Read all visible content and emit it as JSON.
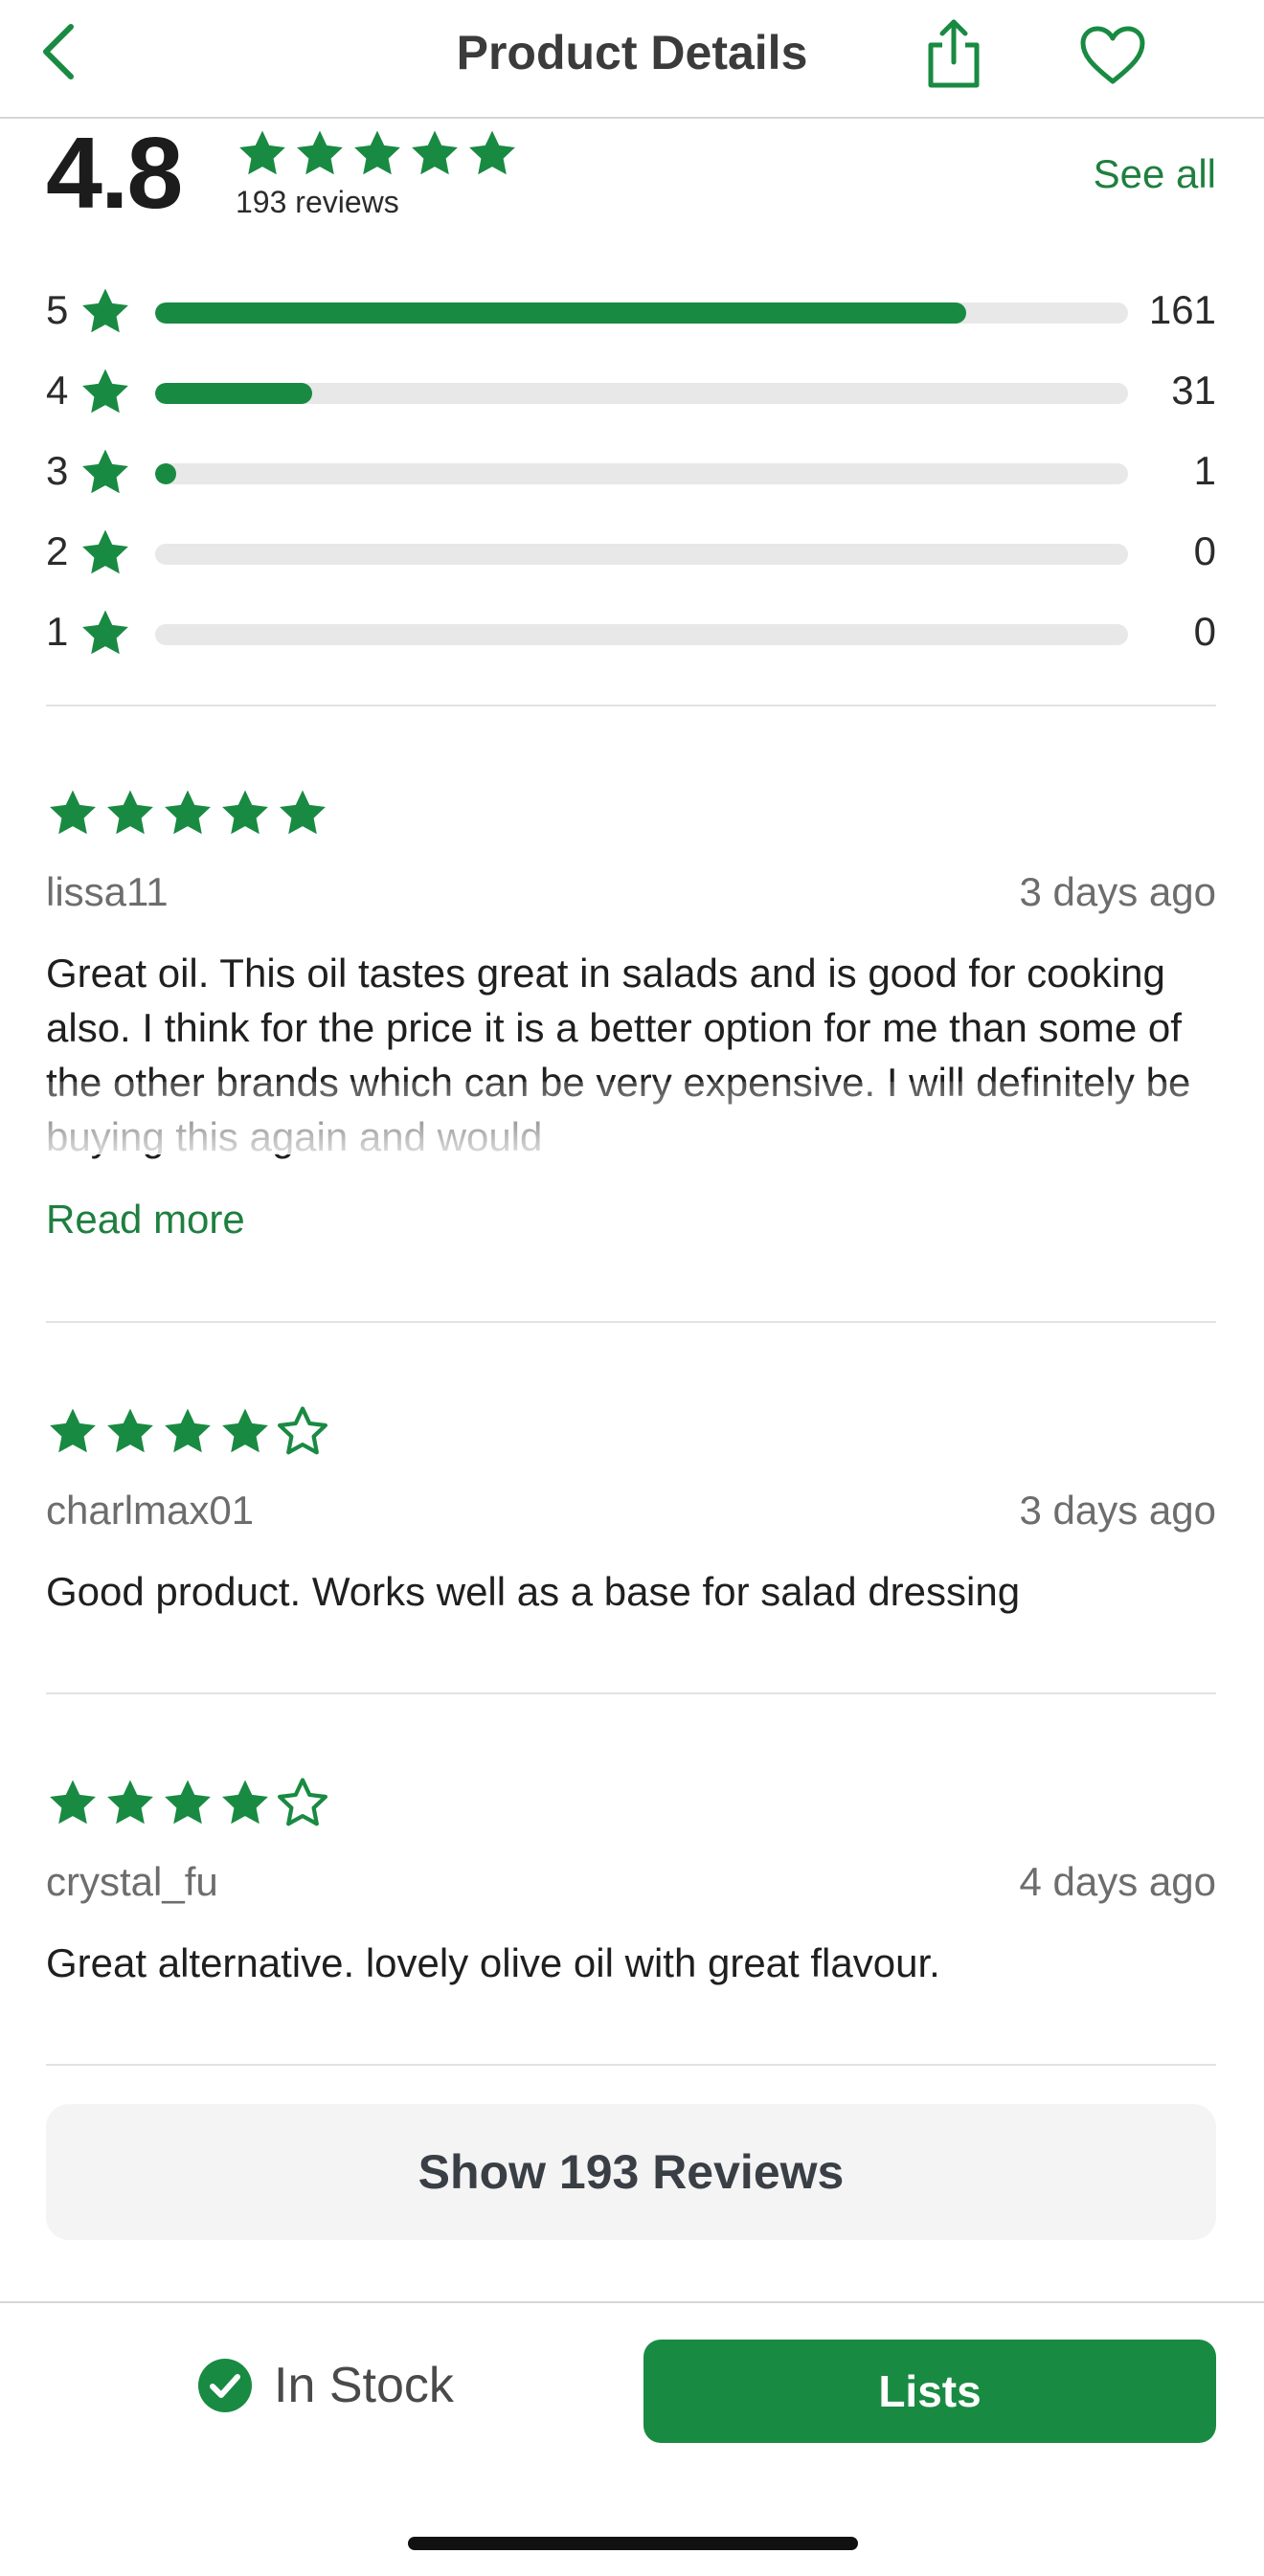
{
  "header": {
    "title": "Product Details",
    "back_icon": "chevron-left-icon",
    "share_icon": "share-icon",
    "favorite_icon": "heart-icon"
  },
  "summary": {
    "average": "4.8",
    "average_stars": 5,
    "review_count_label": "193 reviews",
    "see_all_label": "See all",
    "distribution": [
      {
        "stars": "5",
        "count": "161",
        "fraction": 0.834
      },
      {
        "stars": "4",
        "count": "31",
        "fraction": 0.161
      },
      {
        "stars": "3",
        "count": "1",
        "fraction": 0.005
      },
      {
        "stars": "2",
        "count": "0",
        "fraction": 0
      },
      {
        "stars": "1",
        "count": "0",
        "fraction": 0
      }
    ]
  },
  "reviews": [
    {
      "rating": 5,
      "user": "lissa11",
      "date": "3 days ago",
      "text": "Great oil. This oil tastes great in salads and is good for cooking also. I think for the price it is a better option for me than some of the other brands which can be very expensive. I will definitely be buying this again and would",
      "read_more_label": "Read more"
    },
    {
      "rating": 4,
      "user": "charlmax01",
      "date": "3 days ago",
      "text": "Good product. Works well as a base for salad dressing"
    },
    {
      "rating": 4,
      "user": "crystal_fu",
      "date": "4 days ago",
      "text": "Great alternative. lovely olive oil with great flavour."
    }
  ],
  "show_reviews_label": "Show 193 Reviews",
  "bottom_bar": {
    "stock_label": "In Stock",
    "stock_icon": "check-circle-icon",
    "lists_label": "Lists"
  },
  "colors": {
    "accent": "#198a42",
    "link": "#1f7f3f",
    "track": "#e8e8e8",
    "muted_text": "#6d6d6d"
  }
}
